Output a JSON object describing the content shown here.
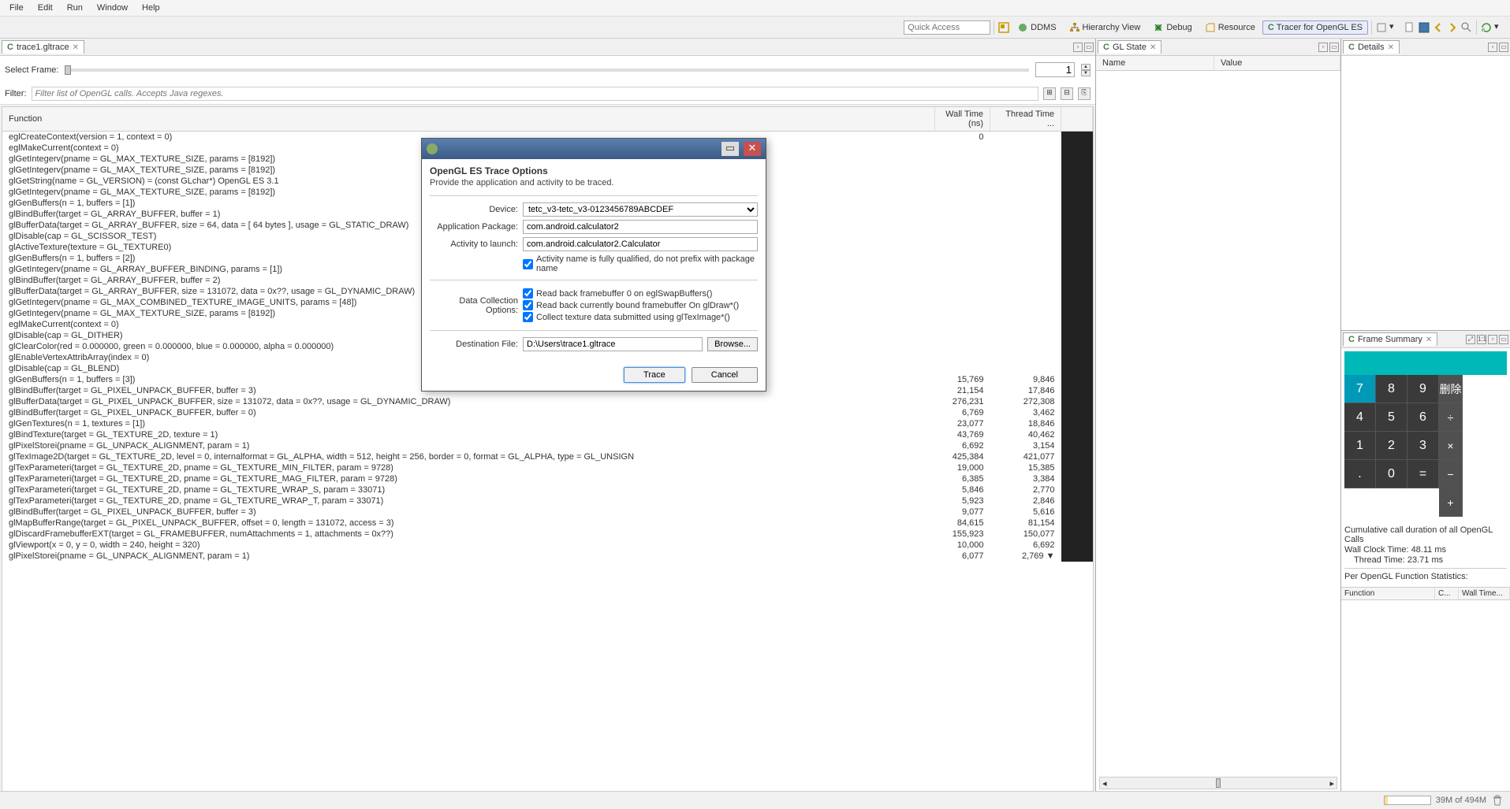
{
  "menu": [
    "File",
    "Edit",
    "Run",
    "Window",
    "Help"
  ],
  "quick_access_placeholder": "Quick Access",
  "perspectives": [
    {
      "label": "DDMS"
    },
    {
      "label": "Hierarchy View"
    },
    {
      "label": "Debug"
    },
    {
      "label": "Resource"
    },
    {
      "label": "Tracer for OpenGL ES",
      "active": true
    }
  ],
  "trace_tab": "trace1.gltrace",
  "select_frame_label": "Select Frame:",
  "frame_value": "1",
  "filter_label": "Filter:",
  "filter_placeholder": "Filter list of OpenGL calls. Accepts Java regexes.",
  "columns": {
    "func": "Function",
    "wall": "Wall Time (ns)",
    "thread": "Thread Time ..."
  },
  "rows": [
    {
      "f": "eglCreateContext(version = 1, context = 0)",
      "w": "0",
      "t": ""
    },
    {
      "f": "eglMakeCurrent(context = 0)",
      "w": "",
      "t": ""
    },
    {
      "f": "glGetIntegerv(pname = GL_MAX_TEXTURE_SIZE, params = [8192])",
      "w": "",
      "t": ""
    },
    {
      "f": "glGetIntegerv(pname = GL_MAX_TEXTURE_SIZE, params = [8192])",
      "w": "",
      "t": ""
    },
    {
      "f": "glGetString(name = GL_VERSION) = (const GLchar*) OpenGL ES 3.1",
      "w": "",
      "t": ""
    },
    {
      "f": "glGetIntegerv(pname = GL_MAX_TEXTURE_SIZE, params = [8192])",
      "w": "",
      "t": ""
    },
    {
      "f": "glGenBuffers(n = 1, buffers = [1])",
      "w": "",
      "t": ""
    },
    {
      "f": "glBindBuffer(target = GL_ARRAY_BUFFER, buffer = 1)",
      "w": "",
      "t": ""
    },
    {
      "f": "glBufferData(target = GL_ARRAY_BUFFER, size = 64, data = [ 64 bytes ], usage = GL_STATIC_DRAW)",
      "w": "",
      "t": ""
    },
    {
      "f": "glDisable(cap = GL_SCISSOR_TEST)",
      "w": "",
      "t": ""
    },
    {
      "f": "glActiveTexture(texture = GL_TEXTURE0)",
      "w": "",
      "t": ""
    },
    {
      "f": "glGenBuffers(n = 1, buffers = [2])",
      "w": "",
      "t": ""
    },
    {
      "f": "glGetIntegerv(pname = GL_ARRAY_BUFFER_BINDING, params = [1])",
      "w": "",
      "t": ""
    },
    {
      "f": "glBindBuffer(target = GL_ARRAY_BUFFER, buffer = 2)",
      "w": "",
      "t": ""
    },
    {
      "f": "glBufferData(target = GL_ARRAY_BUFFER, size = 131072, data = 0x??, usage = GL_DYNAMIC_DRAW)",
      "w": "",
      "t": ""
    },
    {
      "f": "glGetIntegerv(pname = GL_MAX_COMBINED_TEXTURE_IMAGE_UNITS, params = [48])",
      "w": "",
      "t": ""
    },
    {
      "f": "glGetIntegerv(pname = GL_MAX_TEXTURE_SIZE, params = [8192])",
      "w": "",
      "t": ""
    },
    {
      "f": "eglMakeCurrent(context = 0)",
      "w": "",
      "t": ""
    },
    {
      "f": "glDisable(cap = GL_DITHER)",
      "w": "",
      "t": ""
    },
    {
      "f": "glClearColor(red = 0.000000, green = 0.000000, blue = 0.000000, alpha = 0.000000)",
      "w": "",
      "t": ""
    },
    {
      "f": "glEnableVertexAttribArray(index = 0)",
      "w": "",
      "t": ""
    },
    {
      "f": "glDisable(cap = GL_BLEND)",
      "w": "",
      "t": ""
    },
    {
      "f": "glGenBuffers(n = 1, buffers = [3])",
      "w": "15,769",
      "t": "9,846"
    },
    {
      "f": "glBindBuffer(target = GL_PIXEL_UNPACK_BUFFER, buffer = 3)",
      "w": "21,154",
      "t": "17,846"
    },
    {
      "f": "glBufferData(target = GL_PIXEL_UNPACK_BUFFER, size = 131072, data = 0x??, usage = GL_DYNAMIC_DRAW)",
      "w": "276,231",
      "t": "272,308"
    },
    {
      "f": "glBindBuffer(target = GL_PIXEL_UNPACK_BUFFER, buffer = 0)",
      "w": "6,769",
      "t": "3,462"
    },
    {
      "f": "glGenTextures(n = 1, textures = [1])",
      "w": "23,077",
      "t": "18,846"
    },
    {
      "f": "glBindTexture(target = GL_TEXTURE_2D, texture = 1)",
      "w": "43,769",
      "t": "40,462"
    },
    {
      "f": "glPixelStorei(pname = GL_UNPACK_ALIGNMENT, param = 1)",
      "w": "6,692",
      "t": "3,154"
    },
    {
      "f": "glTexImage2D(target = GL_TEXTURE_2D, level = 0, internalformat = GL_ALPHA, width = 512, height = 256, border = 0, format = GL_ALPHA, type = GL_UNSIGN",
      "w": "425,384",
      "t": "421,077"
    },
    {
      "f": "glTexParameteri(target = GL_TEXTURE_2D, pname = GL_TEXTURE_MIN_FILTER, param = 9728)",
      "w": "19,000",
      "t": "15,385"
    },
    {
      "f": "glTexParameteri(target = GL_TEXTURE_2D, pname = GL_TEXTURE_MAG_FILTER, param = 9728)",
      "w": "6,385",
      "t": "3,384"
    },
    {
      "f": "glTexParameteri(target = GL_TEXTURE_2D, pname = GL_TEXTURE_WRAP_S, param = 33071)",
      "w": "5,846",
      "t": "2,770"
    },
    {
      "f": "glTexParameteri(target = GL_TEXTURE_2D, pname = GL_TEXTURE_WRAP_T, param = 33071)",
      "w": "5,923",
      "t": "2,846"
    },
    {
      "f": "glBindBuffer(target = GL_PIXEL_UNPACK_BUFFER, buffer = 3)",
      "w": "9,077",
      "t": "5,616"
    },
    {
      "f": "glMapBufferRange(target = GL_PIXEL_UNPACK_BUFFER, offset = 0, length = 131072, access = 3)",
      "w": "84,615",
      "t": "81,154"
    },
    {
      "f": "glDiscardFramebufferEXT(target = GL_FRAMEBUFFER, numAttachments = 1, attachments = 0x??)",
      "w": "155,923",
      "t": "150,077"
    },
    {
      "f": "glViewport(x = 0, y = 0, width = 240, height = 320)",
      "w": "10,000",
      "t": "6,692"
    },
    {
      "f": "glPixelStorei(pname = GL_UNPACK_ALIGNMENT, param = 1)",
      "w": "6,077",
      "t": "2,769"
    }
  ],
  "gl_state_tab": "GL State",
  "gl_columns": {
    "name": "Name",
    "value": "Value"
  },
  "details_tab": "Details",
  "frame_summary_tab": "Frame Summary",
  "calc": {
    "rows": [
      [
        "7",
        "8",
        "9",
        "删除"
      ],
      [
        "4",
        "5",
        "6",
        "÷"
      ],
      [
        "1",
        "2",
        "3",
        "×"
      ],
      [
        ".",
        "0",
        "=",
        "−"
      ],
      [
        "",
        "",
        "",
        "+"
      ]
    ]
  },
  "summary": {
    "cumulative": "Cumulative call duration of all OpenGL Calls",
    "wall_label": "Wall Clock Time:",
    "wall_value": "48.11 ms",
    "thread_label": "Thread Time:",
    "thread_value": "23.71 ms",
    "per_func": "Per OpenGL Function Statistics:",
    "stat_cols": [
      "Function",
      "C...",
      "Wall Time..."
    ]
  },
  "modal": {
    "title": "OpenGL ES Trace Options",
    "subtitle": "Provide the application and activity to be traced.",
    "device_label": "Device:",
    "device_value": "tetc_v3-tetc_v3-0123456789ABCDEF",
    "package_label": "Application Package:",
    "package_value": "com.android.calculator2",
    "activity_label": "Activity to launch:",
    "activity_value": "com.android.calculator2.Calculator",
    "fqn_check": "Activity name is fully qualified, do not prefix with package name",
    "collection_label": "Data Collection Options:",
    "opt1": "Read back framebuffer 0 on eglSwapBuffers()",
    "opt2": "Read back currently bound framebuffer On glDraw*()",
    "opt3": "Collect texture data submitted using glTexImage*()",
    "dest_label": "Destination File:",
    "dest_value": "D:\\Users\\trace1.gltrace",
    "browse": "Browse...",
    "trace": "Trace",
    "cancel": "Cancel"
  },
  "status": {
    "heap": "39M of 494M"
  }
}
